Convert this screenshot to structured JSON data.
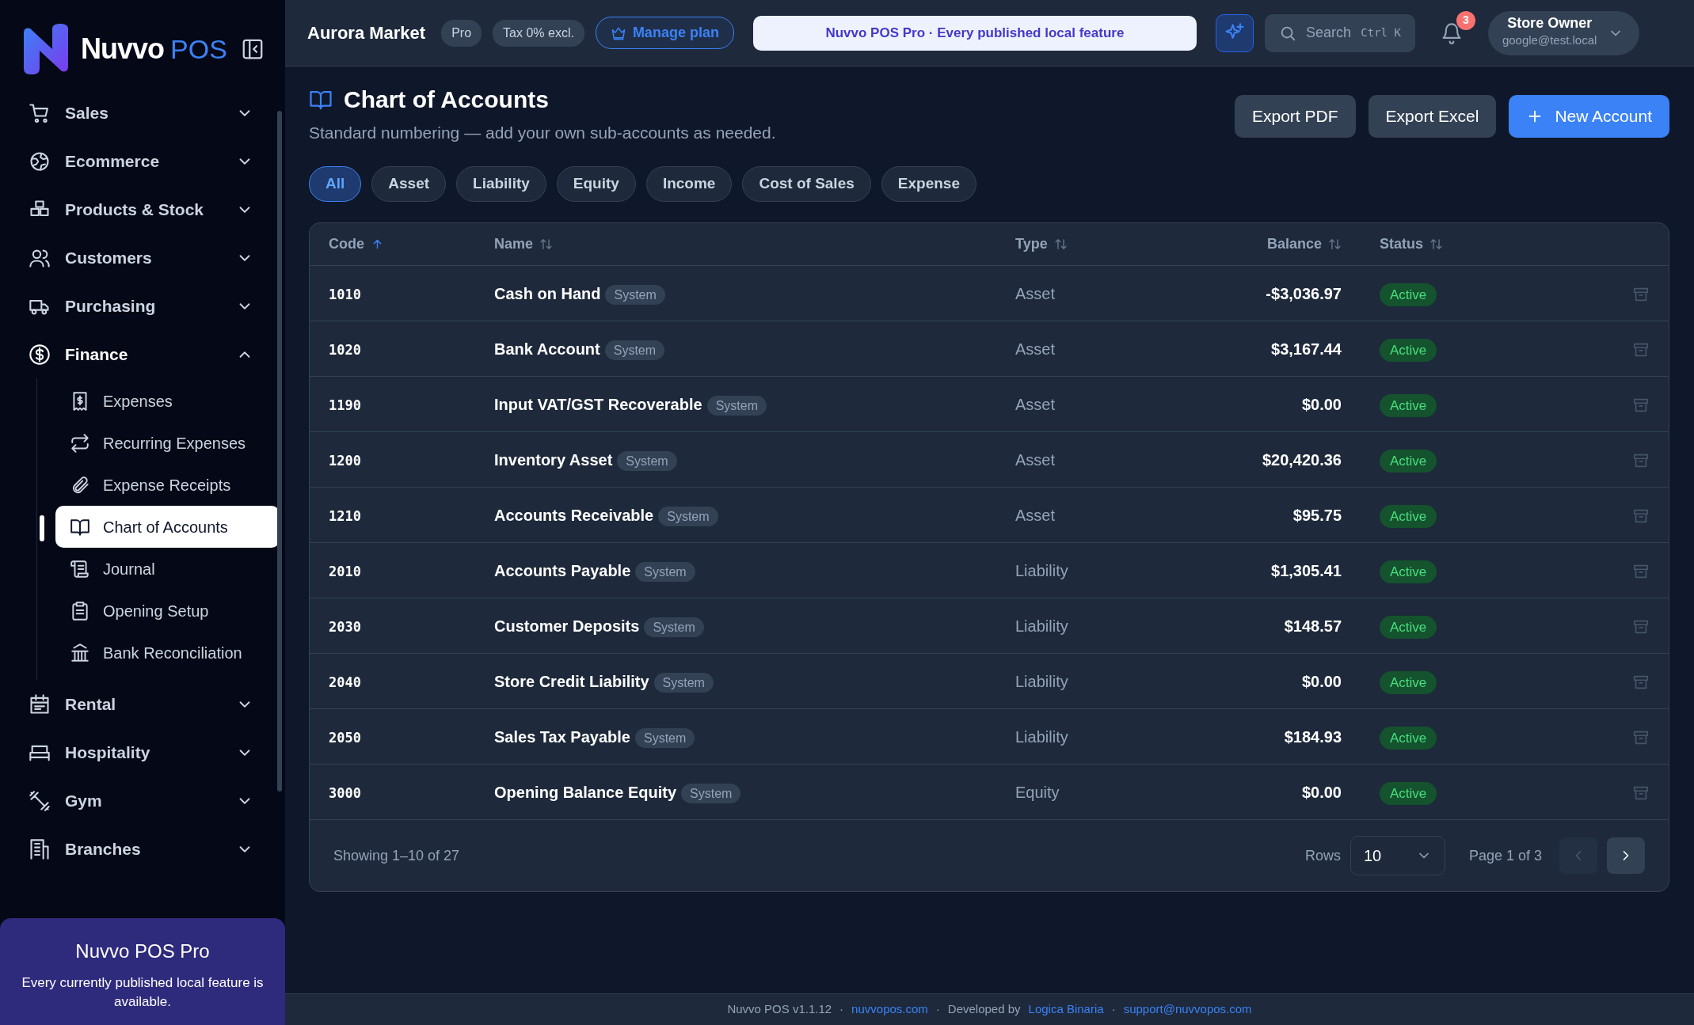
{
  "sidebar": {
    "logo": {
      "word": "Nuvvo",
      "accent": "POS"
    },
    "items": [
      {
        "label": "Sales",
        "expanded": false
      },
      {
        "label": "Ecommerce",
        "expanded": false
      },
      {
        "label": "Products & Stock",
        "expanded": false
      },
      {
        "label": "Customers",
        "expanded": false
      },
      {
        "label": "Purchasing",
        "expanded": false
      },
      {
        "label": "Finance",
        "expanded": true,
        "children": [
          {
            "label": "Expenses",
            "selected": false
          },
          {
            "label": "Recurring Expenses",
            "selected": false
          },
          {
            "label": "Expense Receipts",
            "selected": false
          },
          {
            "label": "Chart of Accounts",
            "selected": true
          },
          {
            "label": "Journal",
            "selected": false
          },
          {
            "label": "Opening Setup",
            "selected": false
          },
          {
            "label": "Bank Reconciliation",
            "selected": false
          }
        ]
      },
      {
        "label": "Rental",
        "expanded": false
      },
      {
        "label": "Hospitality",
        "expanded": false
      },
      {
        "label": "Gym",
        "expanded": false
      },
      {
        "label": "Branches",
        "expanded": false
      }
    ],
    "promo": {
      "title": "Nuvvo POS Pro",
      "text": "Every currently published local feature is available."
    }
  },
  "topbar": {
    "store": "Aurora Market",
    "badges": [
      "Pro",
      "Tax 0% excl."
    ],
    "manage_plan": "Manage plan",
    "banner": "Nuvvo POS Pro · Every published local feature",
    "search": {
      "placeholder": "Search",
      "shortcut": "Ctrl K"
    },
    "notifications": "3",
    "user": {
      "name": "Store Owner",
      "email": "google@test.local"
    }
  },
  "page": {
    "title": "Chart of Accounts",
    "subtitle": "Standard numbering — add your own sub-accounts as needed.",
    "actions": [
      "Export PDF",
      "Export Excel",
      "New Account"
    ]
  },
  "filters": [
    {
      "label": "All",
      "selected": true
    },
    {
      "label": "Asset",
      "selected": false
    },
    {
      "label": "Liability",
      "selected": false
    },
    {
      "label": "Equity",
      "selected": false
    },
    {
      "label": "Income",
      "selected": false
    },
    {
      "label": "Cost of Sales",
      "selected": false
    },
    {
      "label": "Expense",
      "selected": false
    }
  ],
  "table": {
    "columns": [
      {
        "label": "Code",
        "sorted": true
      },
      {
        "label": "Name",
        "sorted": false
      },
      {
        "label": "Type",
        "sorted": false
      },
      {
        "label": "Balance",
        "sorted": false
      },
      {
        "label": "Status",
        "sorted": false
      }
    ],
    "rows": [
      {
        "code": "1010",
        "name": "Cash on Hand",
        "tag": "System",
        "type": "Asset",
        "balance": "-$3,036.97",
        "status": "Active"
      },
      {
        "code": "1020",
        "name": "Bank Account",
        "tag": "System",
        "type": "Asset",
        "balance": "$3,167.44",
        "status": "Active"
      },
      {
        "code": "1190",
        "name": "Input VAT/GST Recoverable",
        "tag": "System",
        "type": "Asset",
        "balance": "$0.00",
        "status": "Active"
      },
      {
        "code": "1200",
        "name": "Inventory Asset",
        "tag": "System",
        "type": "Asset",
        "balance": "$20,420.36",
        "status": "Active"
      },
      {
        "code": "1210",
        "name": "Accounts Receivable",
        "tag": "System",
        "type": "Asset",
        "balance": "$95.75",
        "status": "Active"
      },
      {
        "code": "2010",
        "name": "Accounts Payable",
        "tag": "System",
        "type": "Liability",
        "balance": "$1,305.41",
        "status": "Active"
      },
      {
        "code": "2030",
        "name": "Customer Deposits",
        "tag": "System",
        "type": "Liability",
        "balance": "$148.57",
        "status": "Active"
      },
      {
        "code": "2040",
        "name": "Store Credit Liability",
        "tag": "System",
        "type": "Liability",
        "balance": "$0.00",
        "status": "Active"
      },
      {
        "code": "2050",
        "name": "Sales Tax Payable",
        "tag": "System",
        "type": "Liability",
        "balance": "$184.93",
        "status": "Active"
      },
      {
        "code": "3000",
        "name": "Opening Balance Equity",
        "tag": "System",
        "type": "Equity",
        "balance": "$0.00",
        "status": "Active"
      }
    ],
    "footer": {
      "showing": "Showing 1–10 of 27",
      "rows_label": "Rows",
      "rows_value": "10",
      "page": "Page 1 of 3",
      "prev_disabled": true
    }
  },
  "footer": [
    {
      "kind": "text",
      "text": "Nuvvo POS v1.1.12"
    },
    {
      "kind": "sep",
      "text": "·"
    },
    {
      "kind": "link",
      "text": "nuvvopos.com"
    },
    {
      "kind": "sep",
      "text": "·"
    },
    {
      "kind": "text",
      "text": "Developed by"
    },
    {
      "kind": "link",
      "text": "Logica Binaria"
    },
    {
      "kind": "sep",
      "text": "·"
    },
    {
      "kind": "link",
      "text": "support@nuvvopos.com"
    }
  ]
}
